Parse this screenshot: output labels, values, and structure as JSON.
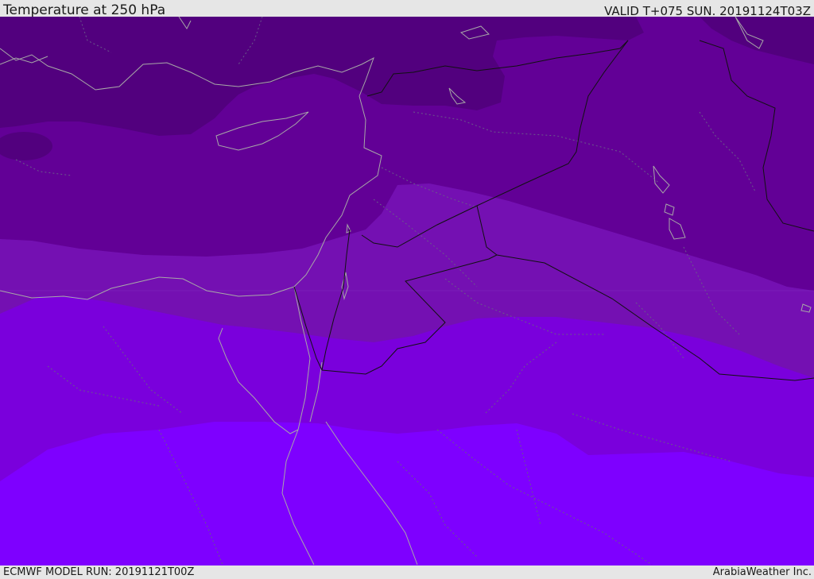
{
  "header": {
    "title": "Temperature at 250 hPa",
    "valid_time": "VALID T+075 SUN. 20191124T03Z"
  },
  "footer": {
    "model_run": "ECMWF MODEL RUN: 20191121T00Z",
    "credit": "ArabiaWeather Inc."
  },
  "map": {
    "variable": "Temperature",
    "level": "250 hPa",
    "colors": {
      "band_darkest": "#52007e",
      "band_dark": "#620096",
      "band_mid": "#7410b2",
      "band_light": "#7a00dc",
      "band_lightest": "#7e00ff",
      "coastline": "#a8a8a8",
      "border": "#111111"
    }
  }
}
